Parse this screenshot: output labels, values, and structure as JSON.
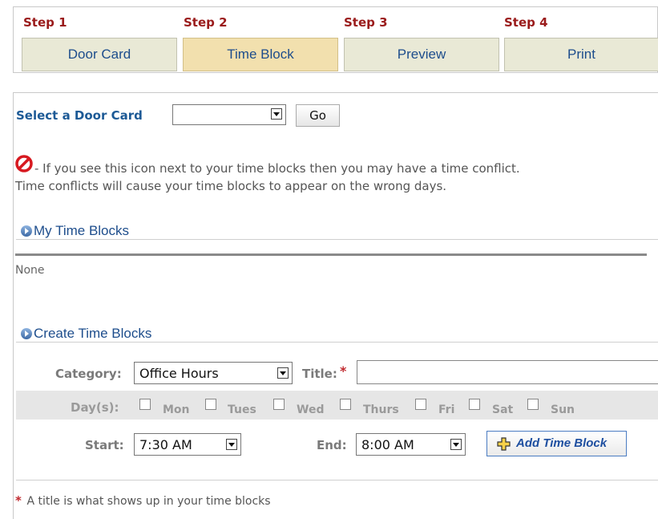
{
  "steps": [
    {
      "number": "Step 1",
      "label": "Door Card"
    },
    {
      "number": "Step 2",
      "label": "Time Block"
    },
    {
      "number": "Step 3",
      "label": "Preview"
    },
    {
      "number": "Step 4",
      "label": "Print"
    }
  ],
  "door_card": {
    "label": "Select a Door Card",
    "selected_value": "",
    "go_label": "Go"
  },
  "conflict_note": {
    "line1": " - If you see this icon next to your time blocks then you may have a time conflict.",
    "line2": "Time conflicts will cause your time blocks to appear on the wrong days."
  },
  "my_time_blocks": {
    "heading": "My Time Blocks",
    "empty_text": "None"
  },
  "create": {
    "heading": "Create Time Blocks",
    "category_label": "Category:",
    "category_value": "Office Hours",
    "title_label": "Title:",
    "required_mark": "*",
    "title_value": "",
    "days_label": "Day(s):",
    "days": [
      "Mon",
      "Tues",
      "Wed",
      "Thurs",
      "Fri",
      "Sat",
      "Sun"
    ],
    "start_label": "Start:",
    "start_value": "7:30 AM",
    "end_label": "End:",
    "end_value": "8:00 AM",
    "add_label": "Add Time Block"
  },
  "footnote": {
    "mark": "*",
    "text": " A title is what shows up in your time blocks"
  },
  "colors": {
    "accent_red": "#9a1b1b",
    "link_blue": "#1d5a96",
    "active_step": "#f2e0ae"
  }
}
